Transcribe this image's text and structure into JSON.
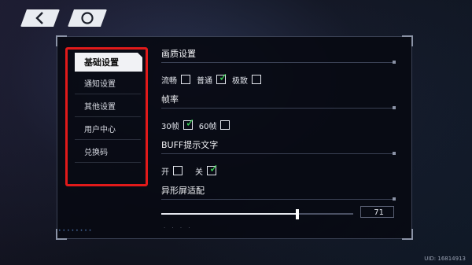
{
  "nav": {
    "back_icon": "chevron-left-icon",
    "home_icon": "circle-icon"
  },
  "sidebar": {
    "items": [
      {
        "label": "基础设置",
        "active": true
      },
      {
        "label": "通知设置",
        "active": false
      },
      {
        "label": "其他设置",
        "active": false
      },
      {
        "label": "用户中心",
        "active": false
      },
      {
        "label": "兑换码",
        "active": false
      }
    ]
  },
  "sections": {
    "quality": {
      "title": "画质设置",
      "options": [
        {
          "label": "流畅",
          "checked": false
        },
        {
          "label": "普通",
          "checked": true
        },
        {
          "label": "极致",
          "checked": false
        }
      ]
    },
    "framerate": {
      "title": "帧率",
      "options": [
        {
          "label": "30帧",
          "checked": true
        },
        {
          "label": "60帧",
          "checked": false
        }
      ]
    },
    "buff_text": {
      "title": "BUFF提示文字",
      "options": [
        {
          "label": "开",
          "checked": false
        },
        {
          "label": "关",
          "checked": true
        }
      ]
    },
    "notch": {
      "title": "异形屏适配",
      "slider_value": "71",
      "slider_fraction": 0.71
    }
  },
  "footer": {
    "uid": "UID: 16814913"
  },
  "colors": {
    "highlight_border": "#e11a1a",
    "check": "#3fe05c"
  }
}
